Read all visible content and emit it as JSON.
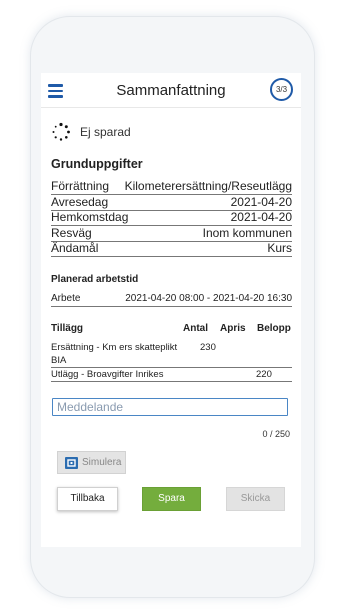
{
  "header": {
    "title": "Sammanfattning",
    "step": "3/3"
  },
  "status": {
    "text": "Ej sparad"
  },
  "basic": {
    "title": "Grunduppgifter",
    "rows": [
      {
        "label": "Förrättning",
        "value": "Kilometerersättning/Reseutlägg"
      },
      {
        "label": "Avresedag",
        "value": "2021-04-20"
      },
      {
        "label": "Hemkomstdag",
        "value": "2021-04-20"
      },
      {
        "label": "Resväg",
        "value": "Inom kommunen"
      },
      {
        "label": "Ändamål",
        "value": "Kurs"
      }
    ]
  },
  "planned": {
    "title": "Planerad arbetstid",
    "row": {
      "label": "Arbete",
      "value": "2021-04-20 08:00 - 2021-04-20 16:30"
    }
  },
  "additions": {
    "headers": {
      "name": "Tillägg",
      "count": "Antal",
      "rate": "Apris",
      "amount": "Belopp"
    },
    "rows": [
      {
        "line1": "Ersättning - Km ers skatteplikt",
        "count": "230",
        "line2": "BIA",
        "amount": ""
      },
      {
        "line1": "Utlägg - Broavgifter Inrikes",
        "count": "",
        "line2": "",
        "amount": "220"
      }
    ]
  },
  "message": {
    "placeholder": "Meddelande",
    "value": "",
    "counter": "0 / 250"
  },
  "buttons": {
    "simulate": "Simulera",
    "back": "Tillbaka",
    "save": "Spara",
    "send": "Skicka"
  },
  "colors": {
    "accent": "#1f5aa8",
    "save": "#74ad3d",
    "disabled": "#e3e3e3"
  }
}
